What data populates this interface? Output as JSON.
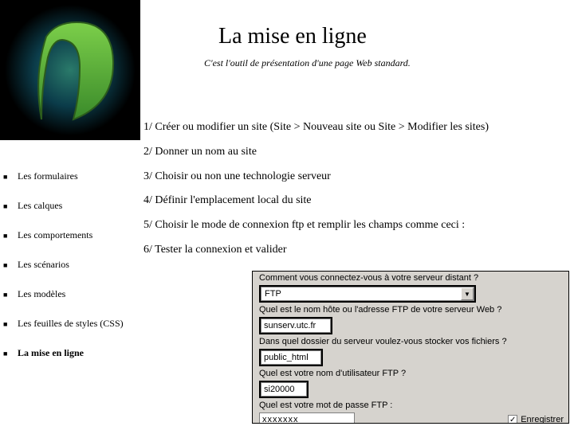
{
  "title": "La mise en ligne",
  "subtitle": "C'est l'outil de présentation d'une page Web standard.",
  "steps": [
    "1/ Créer ou modifier un site (Site > Nouveau site ou Site > Modifier les sites)",
    "2/ Donner un nom au site",
    "3/ Choisir ou non une technologie serveur",
    "4/ Définir l'emplacement local du site",
    "5/ Choisir le mode de connexion ftp et remplir les champs comme ceci :",
    "6/ Tester la connexion et valider"
  ],
  "sidebar": {
    "items": [
      {
        "label": "Les formulaires",
        "active": false
      },
      {
        "label": "Les calques",
        "active": false
      },
      {
        "label": "Les comportements",
        "active": false
      },
      {
        "label": "Les scénarios",
        "active": false
      },
      {
        "label": "Les modèles",
        "active": false
      },
      {
        "label": "Les feuilles de styles (CSS)",
        "active": false
      },
      {
        "label": "La mise en ligne",
        "active": true
      }
    ]
  },
  "dialog": {
    "q_connection": "Comment vous connectez-vous à votre serveur distant ?",
    "connection_value": "FTP",
    "q_host": "Quel est le nom hôte ou l'adresse FTP de votre serveur Web ?",
    "host_value": "sunserv.utc.fr",
    "q_folder": "Dans quel dossier du serveur voulez-vous stocker vos fichiers ?",
    "folder_value": "public_html",
    "q_user": "Quel est votre nom d'utilisateur FTP ?",
    "user_value": "si20000",
    "q_pass": "Quel est votre mot de passe FTP :",
    "pass_value": "xxxxxxx",
    "save_label": "Enregistrer",
    "save_checked": "✓"
  }
}
